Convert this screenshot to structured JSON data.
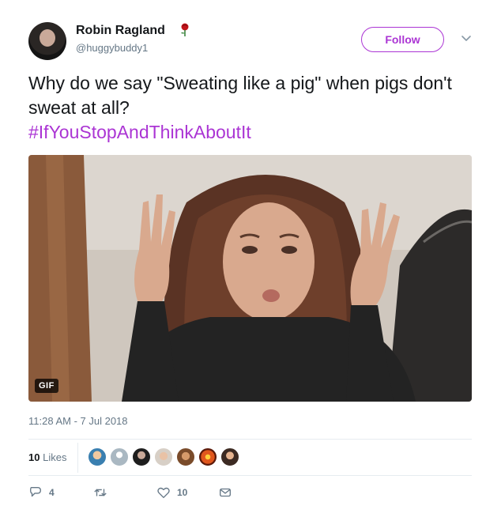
{
  "author": {
    "name": "Robin Ragland",
    "handle": "@huggybuddy1",
    "badge_icon": "rose-icon"
  },
  "follow_button": {
    "label": "Follow"
  },
  "menu": {
    "icon": "chevron-down-icon"
  },
  "tweet": {
    "text": "Why do we say \"Sweating like a pig\" when pigs don't sweat at all?",
    "hashtag": "#IfYouStopAndThinkAboutIt"
  },
  "media": {
    "badge": "GIF"
  },
  "timestamp": "11:28 AM - 7 Jul 2018",
  "likes": {
    "count": "10",
    "label": "Likes",
    "avatars": 7
  },
  "actions": {
    "reply_count": "4",
    "retweet_count": "",
    "like_count": "10",
    "dm_count": ""
  },
  "colors": {
    "accent": "#ab35d4",
    "text": "#14171a",
    "muted": "#657786",
    "divider": "#e6ecf0"
  }
}
